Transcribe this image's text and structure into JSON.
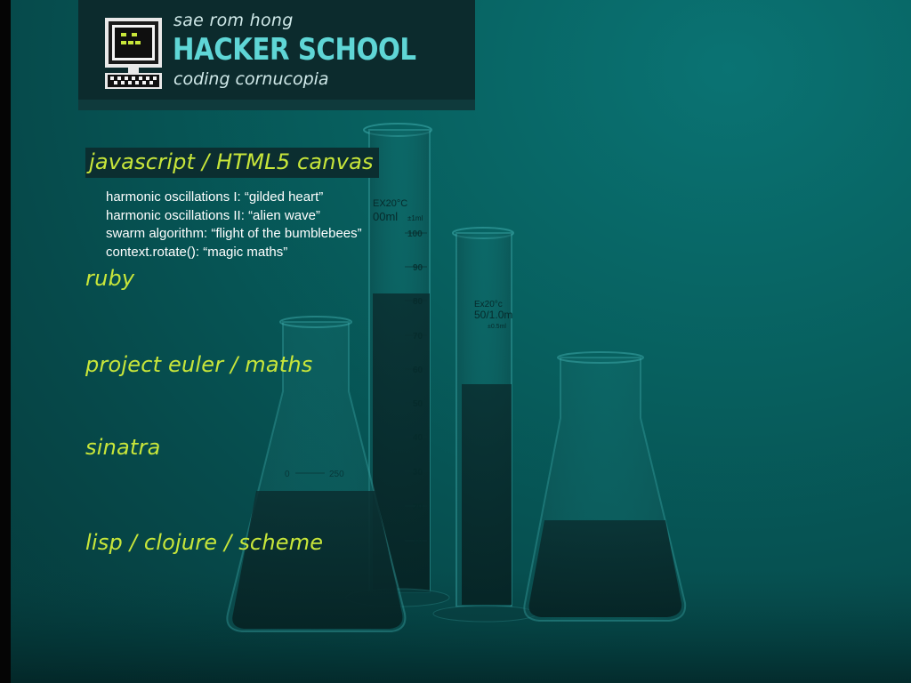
{
  "header": {
    "author": "sae rom hong",
    "title": "HACKER SCHOOL",
    "tagline": "coding cornucopia",
    "logo_icon": "pixel-computer-icon"
  },
  "colors": {
    "background": "#07605f",
    "header_bg": "#0c2b2d",
    "title": "#5fd6d6",
    "section": "#c8e63a",
    "text": "#ffffff"
  },
  "sections": [
    {
      "title": "javascript / HTML5 canvas",
      "items": [
        "harmonic oscillations I: “gilded heart”",
        "harmonic oscillations II: “alien wave”",
        "swarm algorithm: “flight of the bumblebees”",
        "context.rotate(): “magic maths”"
      ]
    },
    {
      "title": "ruby",
      "items": []
    },
    {
      "title": "project euler / maths",
      "items": []
    },
    {
      "title": "sinatra",
      "items": []
    },
    {
      "title": "lisp / clojure / scheme",
      "items": []
    }
  ],
  "background_labels": {
    "cylinder_top": "EX20°C",
    "cylinder_volume": "00ml",
    "cylinder_tolerance": "±1ml",
    "cylinder_ticks": [
      "100",
      "90",
      "80",
      "70",
      "60",
      "50",
      "40",
      "30",
      "20",
      "10"
    ],
    "small_cylinder_top": "Ex20°c",
    "small_cylinder_volume": "50/1.0m",
    "small_cylinder_tolerance": "±0.5ml",
    "flask_mark": "250"
  }
}
